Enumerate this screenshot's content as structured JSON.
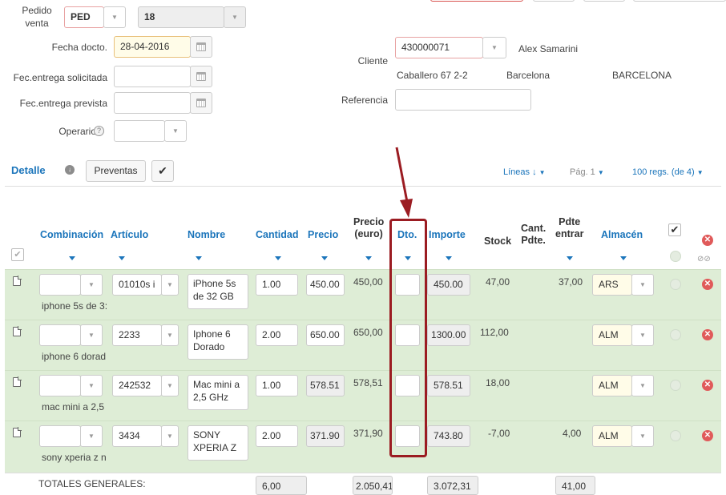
{
  "header": {
    "pedido_label": "Pedido\nventa",
    "pedido_serie": "PED",
    "pedido_num": "18",
    "fecha_docto_label": "Fecha docto.",
    "fecha_docto": "28-04-2016",
    "fec_solicitada_label": "Fec.entrega solicitada",
    "fec_prevista_label": "Fec.entrega prevista",
    "operario_label": "Operario",
    "cliente_label": "Cliente",
    "cliente_codigo": "430000071",
    "cliente_nombre": "Alex Samarini",
    "direccion": "Caballero 67 2-2",
    "ciudad": "Barcelona",
    "provincia": "BARCELONA",
    "referencia_label": "Referencia"
  },
  "toolbar": {
    "detalle": "Detalle",
    "preventas": "Preventas",
    "lineas": "Líneas ↓",
    "pagina": "Pág. 1",
    "regs": "100 regs. (de 4)"
  },
  "columns": {
    "combinacion": "Combinación",
    "articulo": "Artículo",
    "nombre": "Nombre",
    "cantidad": "Cantidad",
    "precio": "Precio",
    "precio_euro_1": "Precio",
    "precio_euro_2": "(euro)",
    "dto": "Dto.",
    "importe": "Importe",
    "stock": "Stock",
    "cant_pdte_1": "Cant.",
    "cant_pdte_2": "Pdte.",
    "pdte_entrar_1": "Pdte",
    "pdte_entrar_2": "entrar",
    "almacen": "Almacén"
  },
  "rows": [
    {
      "desc": "iphone 5s de 3:",
      "articulo": "01010s i",
      "nombre1": "iPhone 5s",
      "nombre2": "de 32 GB",
      "cantidad": "1.00",
      "precio": "450.00",
      "precio_euro": "450,00",
      "importe": "450.00",
      "stock": "47,00",
      "pdte_entrar": "37,00",
      "almacen": "ARS"
    },
    {
      "desc": "iphone 6 dorad",
      "articulo": "2233",
      "nombre1": "Iphone 6",
      "nombre2": "Dorado",
      "cantidad": "2.00",
      "precio": "650.00",
      "precio_euro": "650,00",
      "importe": "1300.00",
      "stock": "112,00",
      "pdte_entrar": "",
      "almacen": "ALM"
    },
    {
      "desc": "mac mini a 2,5",
      "articulo": "242532",
      "nombre1": "Mac mini a",
      "nombre2": "2,5 GHz",
      "cantidad": "1.00",
      "precio": "578.51",
      "precio_euro": "578,51",
      "importe": "578.51",
      "stock": "18,00",
      "pdte_entrar": "",
      "almacen": "ALM"
    },
    {
      "desc": "sony xperia z n",
      "articulo": "3434",
      "nombre1": "SONY",
      "nombre2": "XPERIA Z",
      "cantidad": "2.00",
      "precio": "371.90",
      "precio_euro": "371,90",
      "importe": "743.80",
      "stock": "-7,00",
      "pdte_entrar": "4,00",
      "almacen": "ALM"
    }
  ],
  "totals": {
    "label": "TOTALES GENERALES:",
    "cantidad": "6,00",
    "precio_euro": "2.050,41",
    "importe": "3.072,31",
    "pdte_entrar": "41,00"
  },
  "colors": {
    "accent": "#1b75bb",
    "row_bg": "#deedd6",
    "highlight": "#9b1c22"
  }
}
